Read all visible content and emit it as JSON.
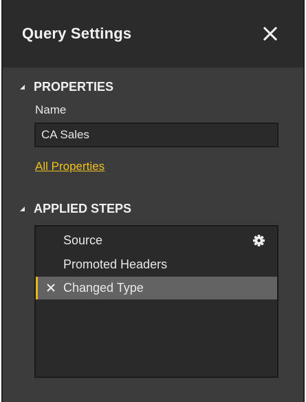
{
  "panel": {
    "title": "Query Settings"
  },
  "properties": {
    "section_label": "PROPERTIES",
    "name_label": "Name",
    "name_value": "CA Sales",
    "link_label": "All Properties"
  },
  "applied_steps": {
    "section_label": "APPLIED STEPS",
    "steps": [
      {
        "label": "Source",
        "icon": "gear-icon"
      },
      {
        "label": "Promoted Headers"
      },
      {
        "label": "Changed Type",
        "selected": true,
        "icon": "delete-icon"
      }
    ]
  },
  "colors": {
    "panel_bg": "#3c3c3c",
    "header_bg": "#2b2b2b",
    "link": "#f0c21b",
    "selected_row": "#636363",
    "selected_accent": "#e8b71a"
  }
}
